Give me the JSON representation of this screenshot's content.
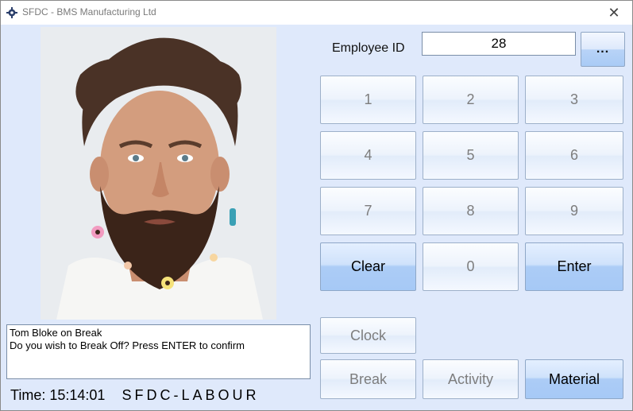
{
  "window": {
    "title": "SFDC - BMS Manufacturing Ltd",
    "close_glyph": "✕"
  },
  "employee": {
    "label": "Employee ID",
    "id_value": "28",
    "lookup_label": "..."
  },
  "keypad": {
    "keys": [
      "1",
      "2",
      "3",
      "4",
      "5",
      "6",
      "7",
      "8",
      "9"
    ],
    "clear_label": "Clear",
    "zero_label": "0",
    "enter_label": "Enter"
  },
  "actions": {
    "clock_label": "Clock",
    "break_label": "Break",
    "activity_label": "Activity",
    "material_label": "Material"
  },
  "message": {
    "line1": "Tom Bloke on Break",
    "line2": "Do you wish to Break Off? Press ENTER to confirm"
  },
  "status": {
    "time_label": "Time:",
    "time_value": "15:14:01",
    "module": "SFDC-LABOUR"
  },
  "colors": {
    "window_bg": "#dfe9fb",
    "active_button": "#a9cbf6",
    "disabled_text": "#7d7d7d"
  }
}
